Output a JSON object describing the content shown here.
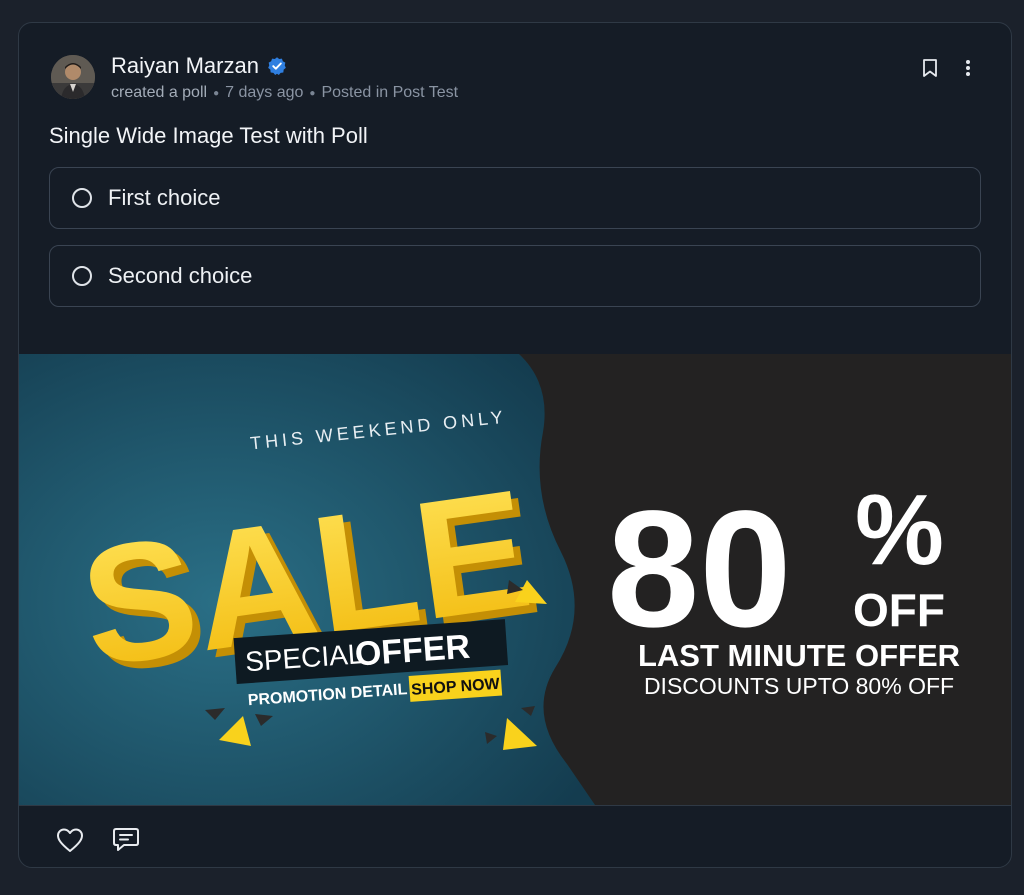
{
  "post": {
    "author": {
      "name": "Raiyan Marzan",
      "verified": true,
      "avatar": "avatar"
    },
    "meta": {
      "action": "created a poll",
      "time": "7 days ago",
      "location": "Posted in Post Test"
    },
    "title": "Single Wide Image Test with Poll",
    "header_icons": [
      "bookmark-icon",
      "more-vertical-icon"
    ]
  },
  "poll": {
    "options": [
      {
        "label": "First choice",
        "selected": false
      },
      {
        "label": "Second choice",
        "selected": false
      }
    ]
  },
  "banner": {
    "tagline": "THIS WEEKEND ONLY",
    "headline": "SALE",
    "special_word": "SPECIAL",
    "offer_word": "OFFER",
    "promotion": "PROMOTION DETAIL",
    "shop_now": "SHOP NOW",
    "percent_value": "80",
    "percent_sign": "%",
    "off": "OFF",
    "last_minute": "LAST MINUTE OFFER",
    "discounts": "DISCOUNTS UPTO 80% OFF",
    "colors": {
      "left_bg": "#1d4f63",
      "right_bg": "#232222",
      "yellow": "#f9d21c"
    }
  },
  "footer": {
    "icons": [
      "heart-icon",
      "comment-icon"
    ]
  },
  "colors": {
    "page_bg": "#1b212b",
    "card_bg": "#151c26",
    "border": "#2f3945",
    "verified": "#2f7fe0"
  }
}
